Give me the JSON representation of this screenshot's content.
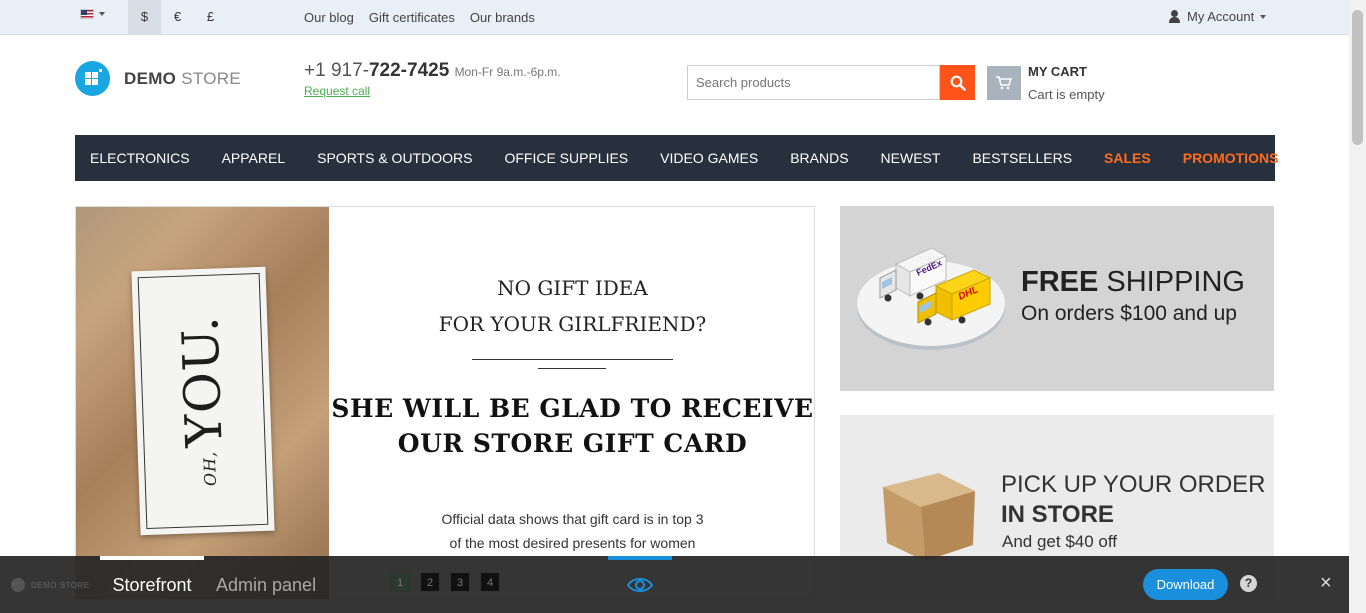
{
  "topbar": {
    "language_icon": "us-flag-icon",
    "currencies": [
      "$",
      "€",
      "£"
    ],
    "active_currency": "$",
    "links": [
      "Our blog",
      "Gift certificates",
      "Our brands"
    ],
    "account_label": "My Account"
  },
  "header": {
    "logo_bold": "DEMO",
    "logo_light": " STORE",
    "phone_prefix": "+1 917-",
    "phone_main": "722-7425",
    "hours": "Mon-Fr 9a.m.-6p.m.",
    "request_call": "Request call",
    "search_placeholder": "Search products",
    "cart_title": "MY CART",
    "cart_status": "Cart is empty"
  },
  "nav": {
    "items": [
      "ELECTRONICS",
      "APPAREL",
      "SPORTS & OUTDOORS",
      "OFFICE SUPPLIES",
      "VIDEO GAMES",
      "BRANDS",
      "NEWEST",
      "BESTSELLERS",
      "SALES",
      "PROMOTIONS"
    ],
    "highlight_color": "#ff6a1f"
  },
  "banner": {
    "card_small": "OH,",
    "card_big": "YOU.",
    "line1": "NO GIFT IDEA",
    "line2": "FOR YOUR GIRLFRIEND?",
    "heading_1": "SHE WILL BE GLAD TO RECEIVE",
    "heading_2": "OUR STORE GIFT CARD",
    "desc_1": "Official data shows that gift card is in top 3",
    "desc_2": "of the most desired presents for women"
  },
  "side_banners": {
    "shipping_bold": "FREE",
    "shipping_rest": " SHIPPING",
    "shipping_sub": "On orders $100 and up",
    "truck_1_label": "FedEx",
    "truck_2_label": "DHL",
    "pickup_1": "PICK UP YOUR ORDER",
    "pickup_2": "IN STORE",
    "pickup_3": "And get $40 off"
  },
  "demobar": {
    "logo_text": "DEMO STORE",
    "tab_storefront": "Storefront",
    "tab_admin": "Admin panel",
    "pages": [
      "1",
      "2",
      "3",
      "4"
    ],
    "download_label": "Download",
    "help_label": "?",
    "close_label": "×",
    "accent_color": "#1a8fdc"
  }
}
